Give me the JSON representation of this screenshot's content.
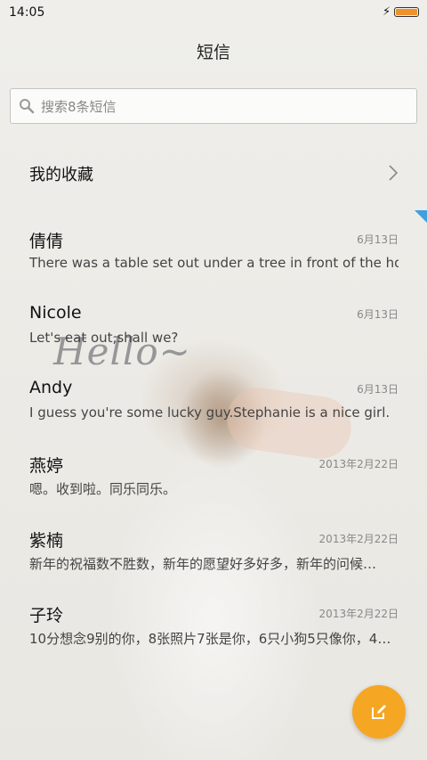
{
  "status_bar": {
    "time": "14:05"
  },
  "header": {
    "title": "短信"
  },
  "search": {
    "placeholder": "搜索8条短信"
  },
  "favorites": {
    "label": "我的收藏"
  },
  "background": {
    "text": "Hello~"
  },
  "threads": [
    {
      "name": "倩倩",
      "date": "6月13日",
      "preview": "There was a table set out under a tree in front of the ho.."
    },
    {
      "name": "Nicole",
      "date": "6月13日",
      "preview": "Let's eat out,shall we?"
    },
    {
      "name": "Andy",
      "date": "6月13日",
      "preview": "I guess you're some lucky guy.Stephanie is a nice girl."
    },
    {
      "name": "燕婷",
      "date": "2013年2月22日",
      "preview": "嗯。收到啦。同乐同乐。"
    },
    {
      "name": "紫楠",
      "date": "2013年2月22日",
      "preview": "新年的祝福数不胜数，新年的愿望好多好多，新年的问候…"
    },
    {
      "name": "子玲",
      "date": "2013年2月22日",
      "preview": "10分想念9别的你，8张照片7张是你，6只小狗5只像你，4…"
    }
  ],
  "colors": {
    "accent": "#f5a623",
    "battery": "#f0912b",
    "marker": "#3da0e0"
  },
  "icons": {
    "search": "search-icon",
    "favorites": "chevron-right-icon",
    "compose": "compose-icon",
    "charging": "charging-icon",
    "battery": "battery-icon"
  }
}
